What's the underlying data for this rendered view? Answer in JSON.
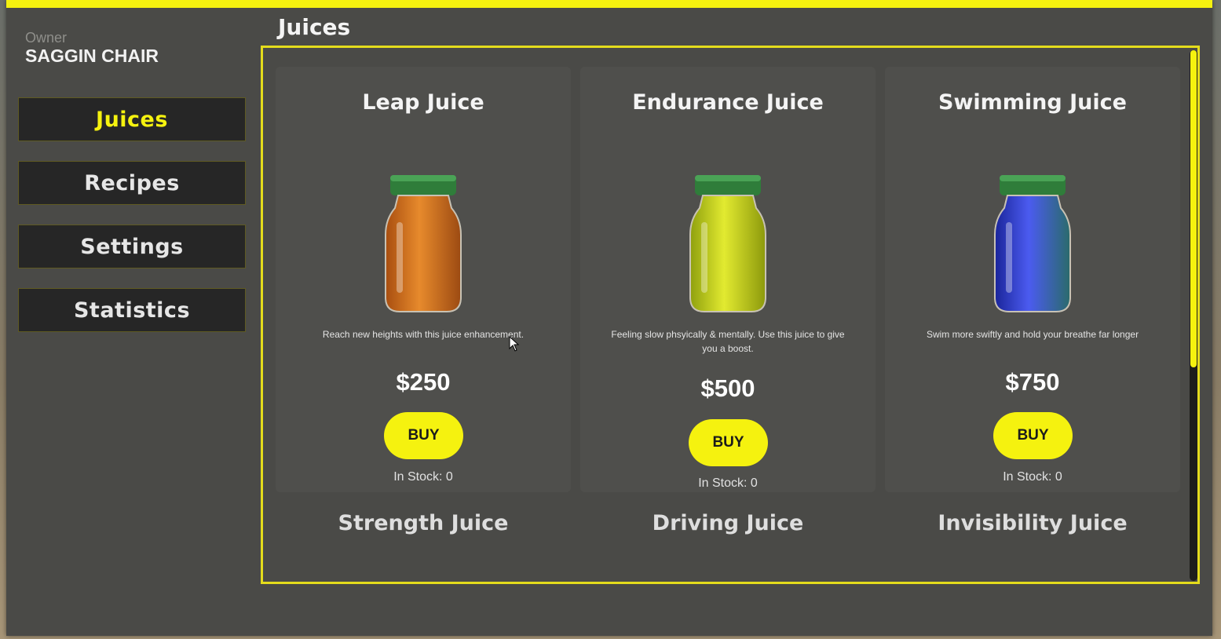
{
  "owner": {
    "label": "Owner",
    "name": "SAGGIN CHAIR"
  },
  "nav": {
    "juices": "Juices",
    "recipes": "Recipes",
    "settings": "Settings",
    "statistics": "Statistics"
  },
  "section_title": "Juices",
  "accent_color": "#f5f20f",
  "products": [
    {
      "name": "Leap Juice",
      "color": "#d9731c",
      "description": "Reach new heights with this juice enhancement.",
      "price": "$250",
      "buy_label": "BUY",
      "stock": "In Stock: 0"
    },
    {
      "name": "Endurance Juice",
      "color": "#c8d41a",
      "description": "Feeling slow phsyically & mentally. Use this juice to give you a boost.",
      "price": "$500",
      "buy_label": "BUY",
      "stock": "In Stock: 0"
    },
    {
      "name": "Swimming Juice",
      "color": "#2f3fd8",
      "description": "Swim more swiftly and hold your breathe far longer",
      "price": "$750",
      "buy_label": "BUY",
      "stock": "In Stock: 0"
    }
  ],
  "next_products": [
    "Strength Juice",
    "Driving Juice",
    "Invisibility Juice"
  ]
}
